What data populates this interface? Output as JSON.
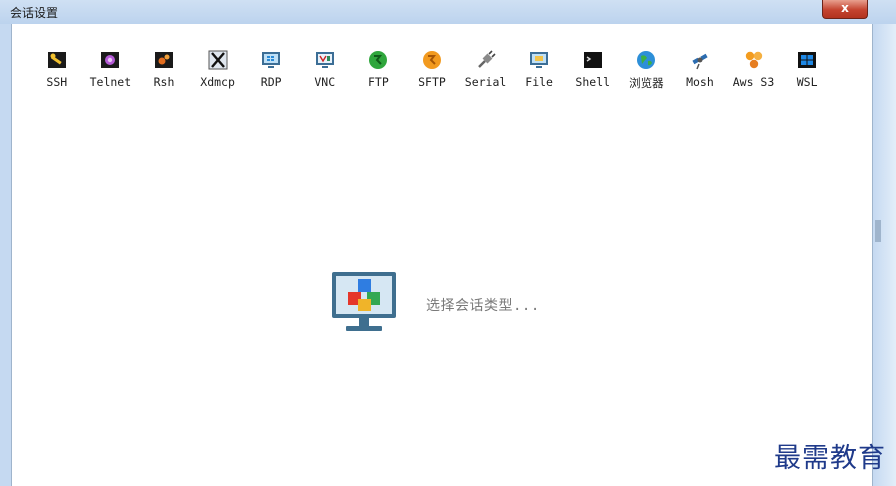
{
  "window": {
    "title": "会话设置",
    "close_label": "x"
  },
  "session_types": [
    {
      "label": "SSH",
      "icon": "ssh-wrench-icon"
    },
    {
      "label": "Telnet",
      "icon": "telnet-icon"
    },
    {
      "label": "Rsh",
      "icon": "rsh-icon"
    },
    {
      "label": "Xdmcp",
      "icon": "xdmcp-x-icon"
    },
    {
      "label": "RDP",
      "icon": "rdp-monitor-icon"
    },
    {
      "label": "VNC",
      "icon": "vnc-monitor-icon"
    },
    {
      "label": "FTP",
      "icon": "ftp-globe-icon"
    },
    {
      "label": "SFTP",
      "icon": "sftp-globe-icon"
    },
    {
      "label": "Serial",
      "icon": "serial-plug-icon"
    },
    {
      "label": "File",
      "icon": "file-monitor-icon"
    },
    {
      "label": "Shell",
      "icon": "shell-terminal-icon"
    },
    {
      "label": "浏览器",
      "icon": "browser-globe-icon"
    },
    {
      "label": "Mosh",
      "icon": "mosh-satellite-icon"
    },
    {
      "label": "Aws S3",
      "icon": "aws-s3-icon"
    },
    {
      "label": "WSL",
      "icon": "wsl-windows-icon"
    }
  ],
  "main": {
    "hint": "选择会话类型...",
    "icon": "session-monitor-cubes-icon"
  },
  "watermark": {
    "text": "最需教育"
  }
}
